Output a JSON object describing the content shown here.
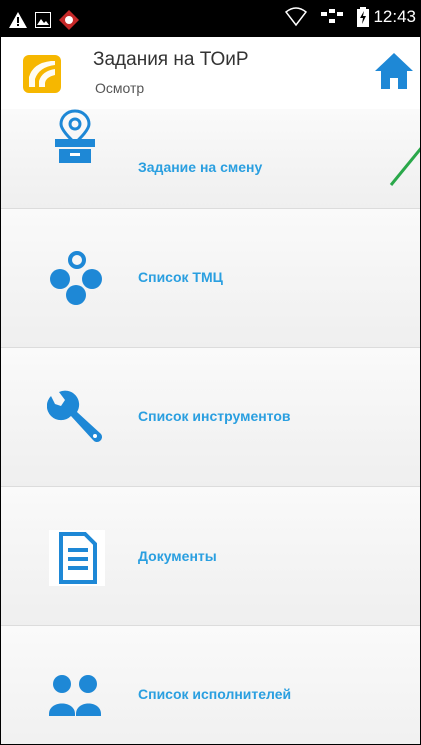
{
  "status_bar": {
    "time": "12:43",
    "icons": [
      "warning-icon",
      "image-icon",
      "app-notification-icon",
      "wifi-icon",
      "network-icon",
      "battery-charging-icon"
    ]
  },
  "header": {
    "title": "Задания на ТОиР",
    "subtitle": "Осмотр",
    "logo_color": "#f6b700",
    "home_color": "#1e88d6"
  },
  "menu": {
    "items": [
      {
        "label": "Задание на смену",
        "icon": "shift-task-icon"
      },
      {
        "label": "Список ТМЦ",
        "icon": "inventory-icon"
      },
      {
        "label": "Список инструментов",
        "icon": "wrench-icon"
      },
      {
        "label": "Документы",
        "icon": "document-icon"
      },
      {
        "label": "Список исполнителей",
        "icon": "people-icon"
      }
    ]
  },
  "colors": {
    "accent": "#2a9fe0",
    "icon_blue": "#1e88d6",
    "pointer_green": "#2aa84a"
  }
}
